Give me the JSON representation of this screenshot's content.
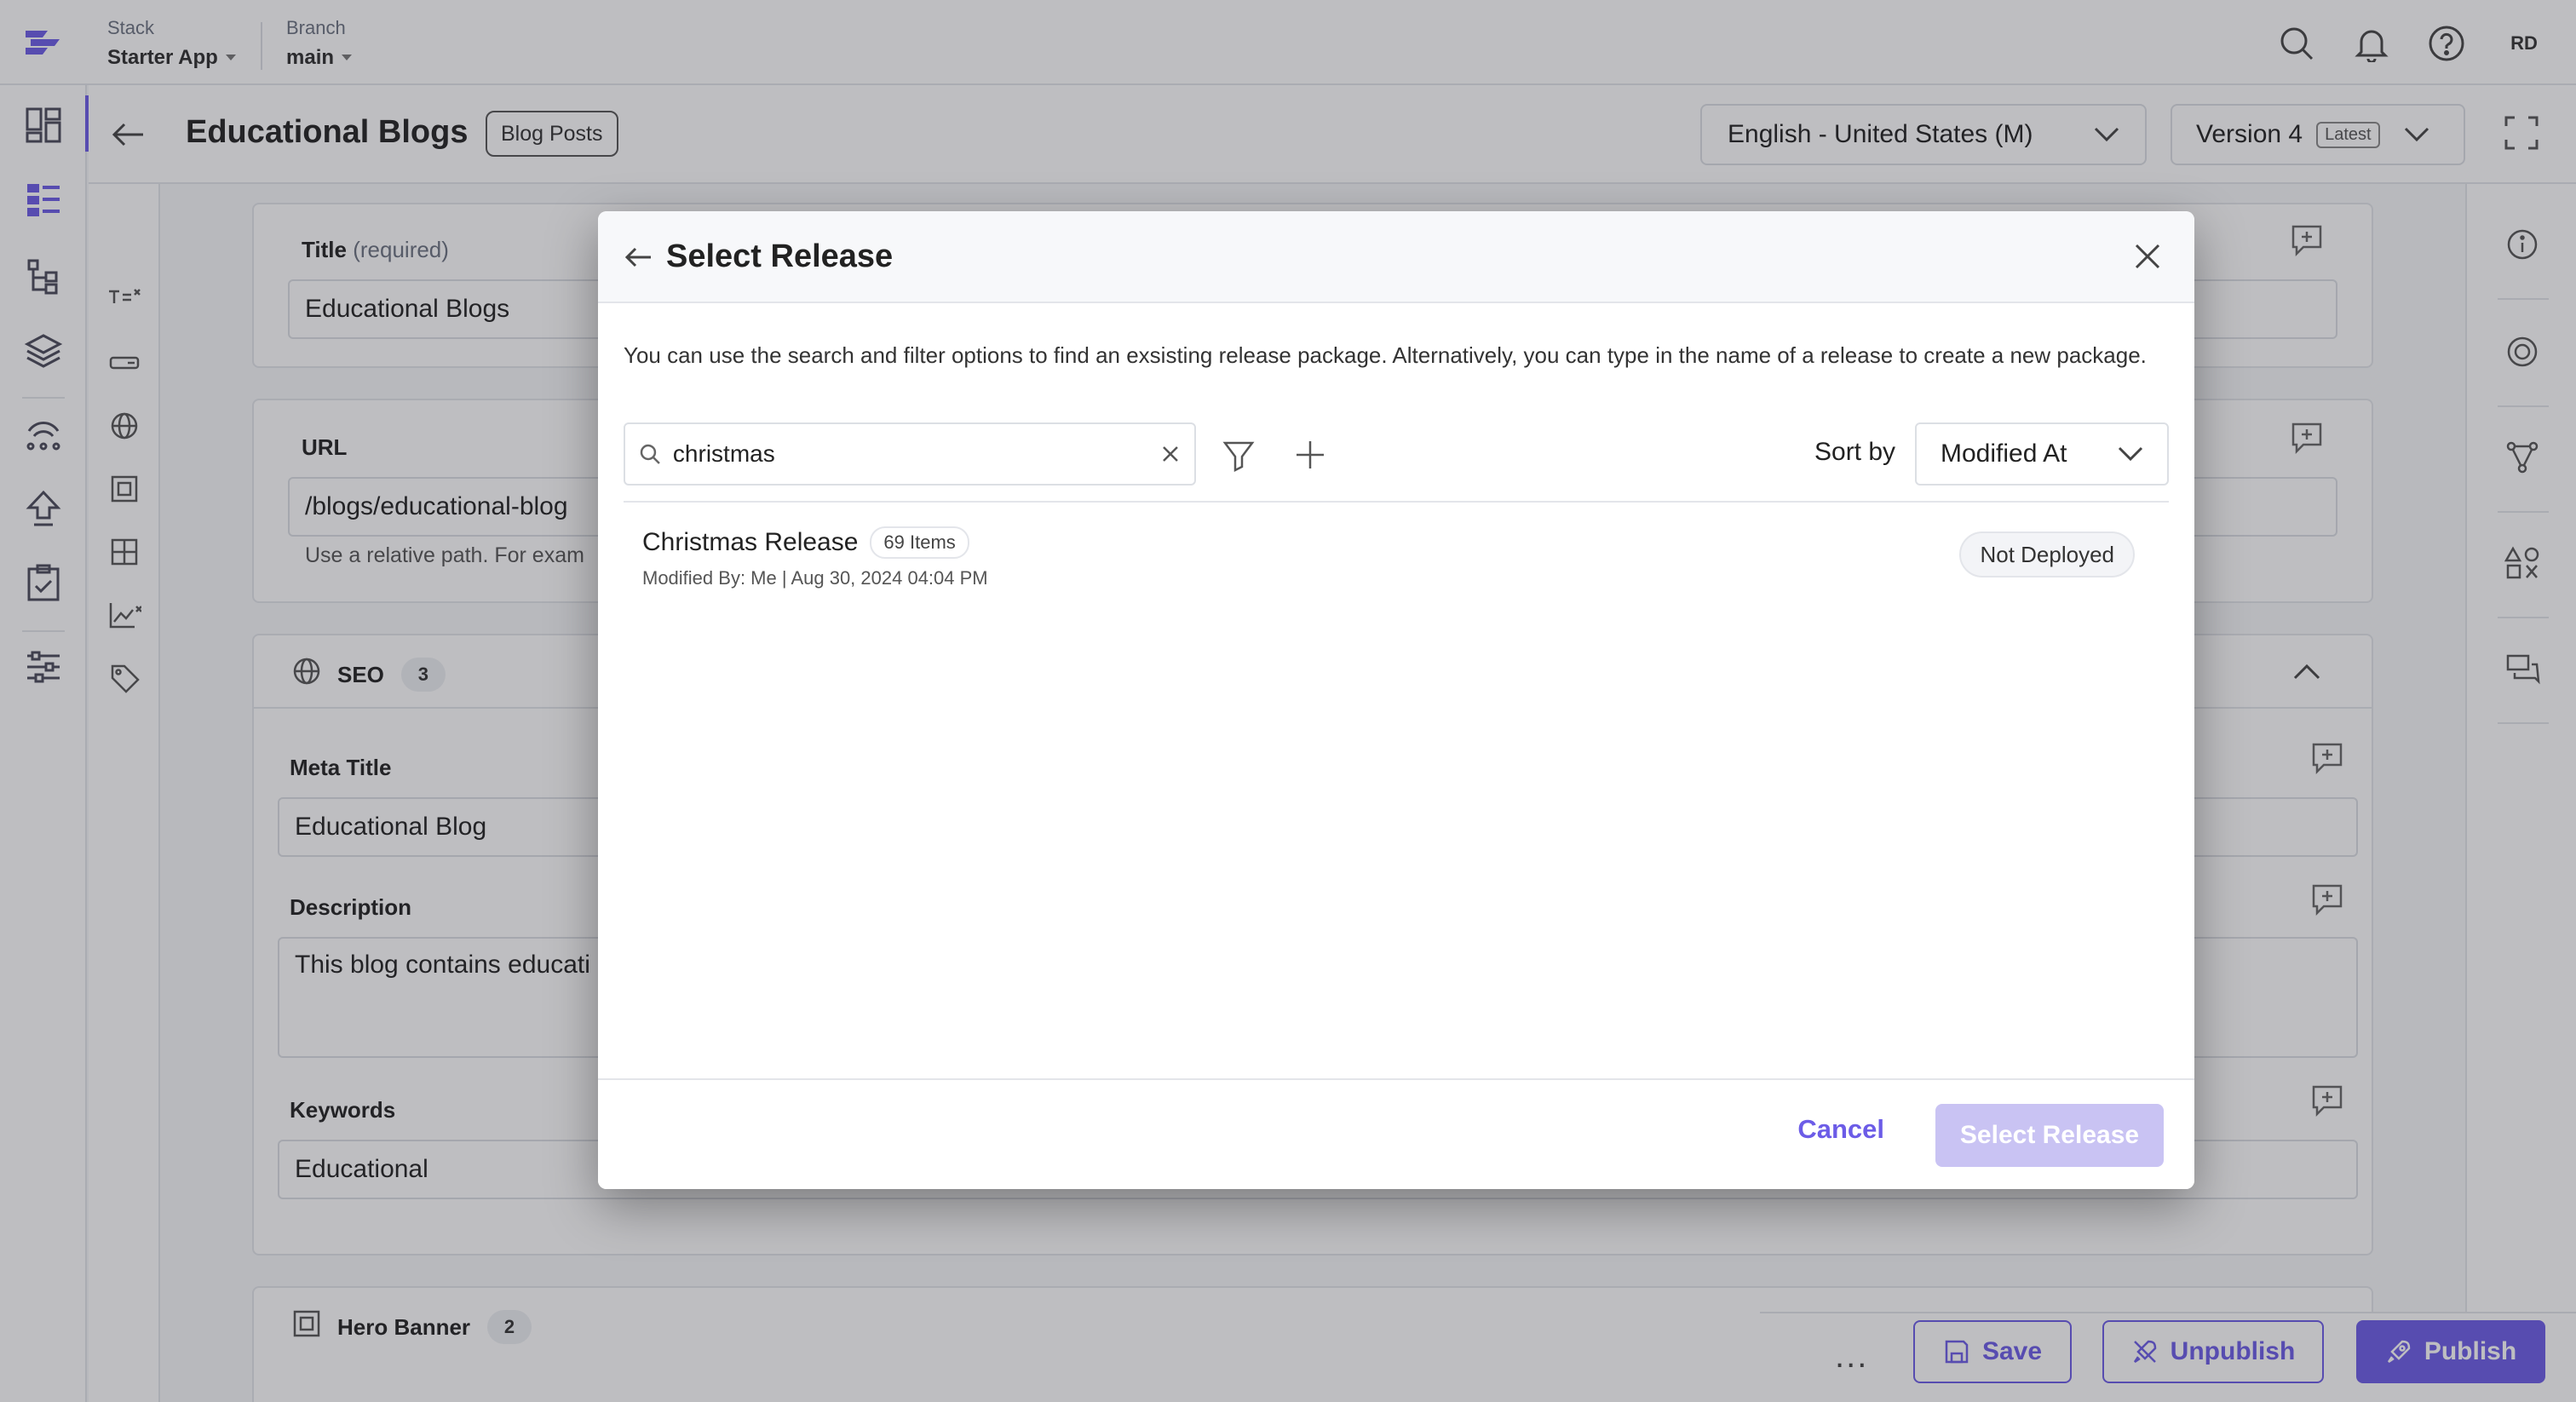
{
  "header": {
    "stack_label": "Stack",
    "stack_value": "Starter App",
    "branch_label": "Branch",
    "branch_value": "main",
    "avatar_initials": "RD"
  },
  "entry": {
    "title": "Educational Blogs",
    "content_type": "Blog Posts",
    "locale": "English - United States (M)",
    "version": "Version 4",
    "version_tag": "Latest"
  },
  "form": {
    "title_label": "Title",
    "title_required": "(required)",
    "title_value": "Educational Blogs",
    "url_label": "URL",
    "url_value": "/blogs/educational-blog",
    "url_hint": "Use a relative path. For exam",
    "seo_label": "SEO",
    "seo_count": "3",
    "meta_title_label": "Meta Title",
    "meta_title_value": "Educational Blog",
    "description_label": "Description",
    "description_value": "This blog contains educati",
    "keywords_label": "Keywords",
    "keywords_value": "Educational",
    "hero_label": "Hero Banner",
    "hero_count": "2"
  },
  "actions": {
    "more": "...",
    "save": "Save",
    "unpublish": "Unpublish",
    "publish": "Publish"
  },
  "modal": {
    "title": "Select Release",
    "description": "You can use the search and filter options to find an exsisting release package. Alternatively, you can type in the name of a release to create a new package.",
    "search_value": "christmas",
    "sort_label": "Sort by",
    "sort_value": "Modified At",
    "releases": [
      {
        "name": "Christmas Release",
        "items": "69 Items",
        "meta": "Modified By: Me | Aug 30, 2024 04:04 PM",
        "status": "Not Deployed"
      }
    ],
    "cancel": "Cancel",
    "select": "Select Release"
  },
  "colors": {
    "accent": "#6c5ce7",
    "accent_disabled": "#c9c3f3"
  }
}
